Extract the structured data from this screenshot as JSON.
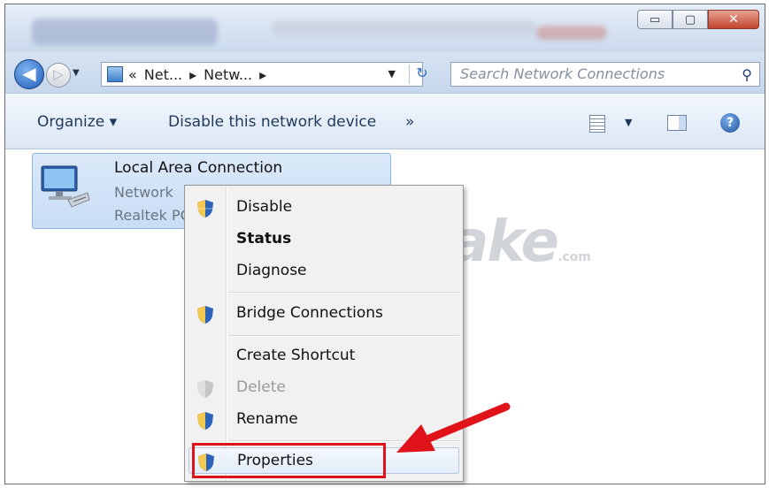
{
  "window": {
    "minimize_label": "▭",
    "maximize_label": "▢",
    "close_label": "✕"
  },
  "nav": {
    "back_label": "◀",
    "forward_label": "▷",
    "breadcrumb_overflow": "«",
    "breadcrumb": [
      "Net...",
      "Netw..."
    ],
    "search_placeholder": "Search Network Connections"
  },
  "toolbar": {
    "organize_label": "Organize ▾",
    "disable_label": "Disable this network device",
    "more_label": "»"
  },
  "connection": {
    "name": "Local Area Connection",
    "status": "Network",
    "adapter": "Realtek PCIe"
  },
  "context_menu": {
    "items": [
      {
        "label": "Disable",
        "shield": true,
        "bold": false,
        "disabled": false
      },
      {
        "label": "Status",
        "shield": false,
        "bold": true,
        "disabled": false
      },
      {
        "label": "Diagnose",
        "shield": false,
        "bold": false,
        "disabled": false
      },
      {
        "label": "Bridge Connections",
        "shield": true,
        "bold": false,
        "disabled": false
      },
      {
        "label": "Create Shortcut",
        "shield": false,
        "bold": false,
        "disabled": false
      },
      {
        "label": "Delete",
        "shield": true,
        "bold": false,
        "disabled": true
      },
      {
        "label": "Rename",
        "shield": true,
        "bold": false,
        "disabled": false
      },
      {
        "label": "Properties",
        "shield": true,
        "bold": false,
        "disabled": false
      }
    ]
  },
  "watermark": {
    "brand": "TipsMake",
    "suffix": ".com"
  },
  "colors": {
    "highlight_box": "#e1131a",
    "accent": "#1e395b"
  }
}
